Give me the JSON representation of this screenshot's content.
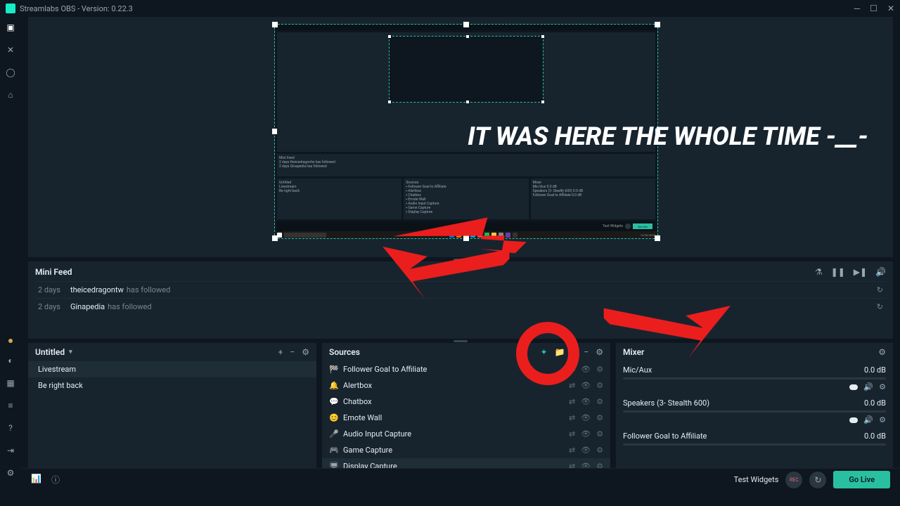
{
  "titlebar": {
    "app": "Streamlabs OBS - Version: 0.22.3"
  },
  "overlay": {
    "text": "IT WAS HERE THE WHOLE TIME -__-"
  },
  "minifeed": {
    "title": "Mini Feed",
    "rows": [
      {
        "time": "2 days",
        "user": "theicedragontw",
        "action": "has followed"
      },
      {
        "time": "2 days",
        "user": "Ginapedia",
        "action": "has followed"
      }
    ]
  },
  "scenes": {
    "title": "Untitled",
    "items": [
      "Livestream",
      "Be right back"
    ]
  },
  "sources": {
    "title": "Sources",
    "items": [
      {
        "icon": "🏁",
        "label": "Follower Goal to Affiliate"
      },
      {
        "icon": "🔔",
        "label": "Alertbox"
      },
      {
        "icon": "💬",
        "label": "Chatbox"
      },
      {
        "icon": "😊",
        "label": "Emote Wall"
      },
      {
        "icon": "🎤",
        "label": "Audio Input Capture"
      },
      {
        "icon": "🎮",
        "label": "Game Capture"
      },
      {
        "icon": "🖥",
        "label": "Display Capture"
      }
    ]
  },
  "mixer": {
    "title": "Mixer",
    "channels": [
      {
        "name": "Mic/Aux",
        "level": "0.0 dB"
      },
      {
        "name": "Speakers (3- Stealth 600)",
        "level": "0.0 dB"
      },
      {
        "name": "Follower Goal to Affiliate",
        "level": "0.0 dB"
      }
    ]
  },
  "bottombar": {
    "test_widgets": "Test Widgets",
    "rec": "REC",
    "golive": "Go Live"
  }
}
